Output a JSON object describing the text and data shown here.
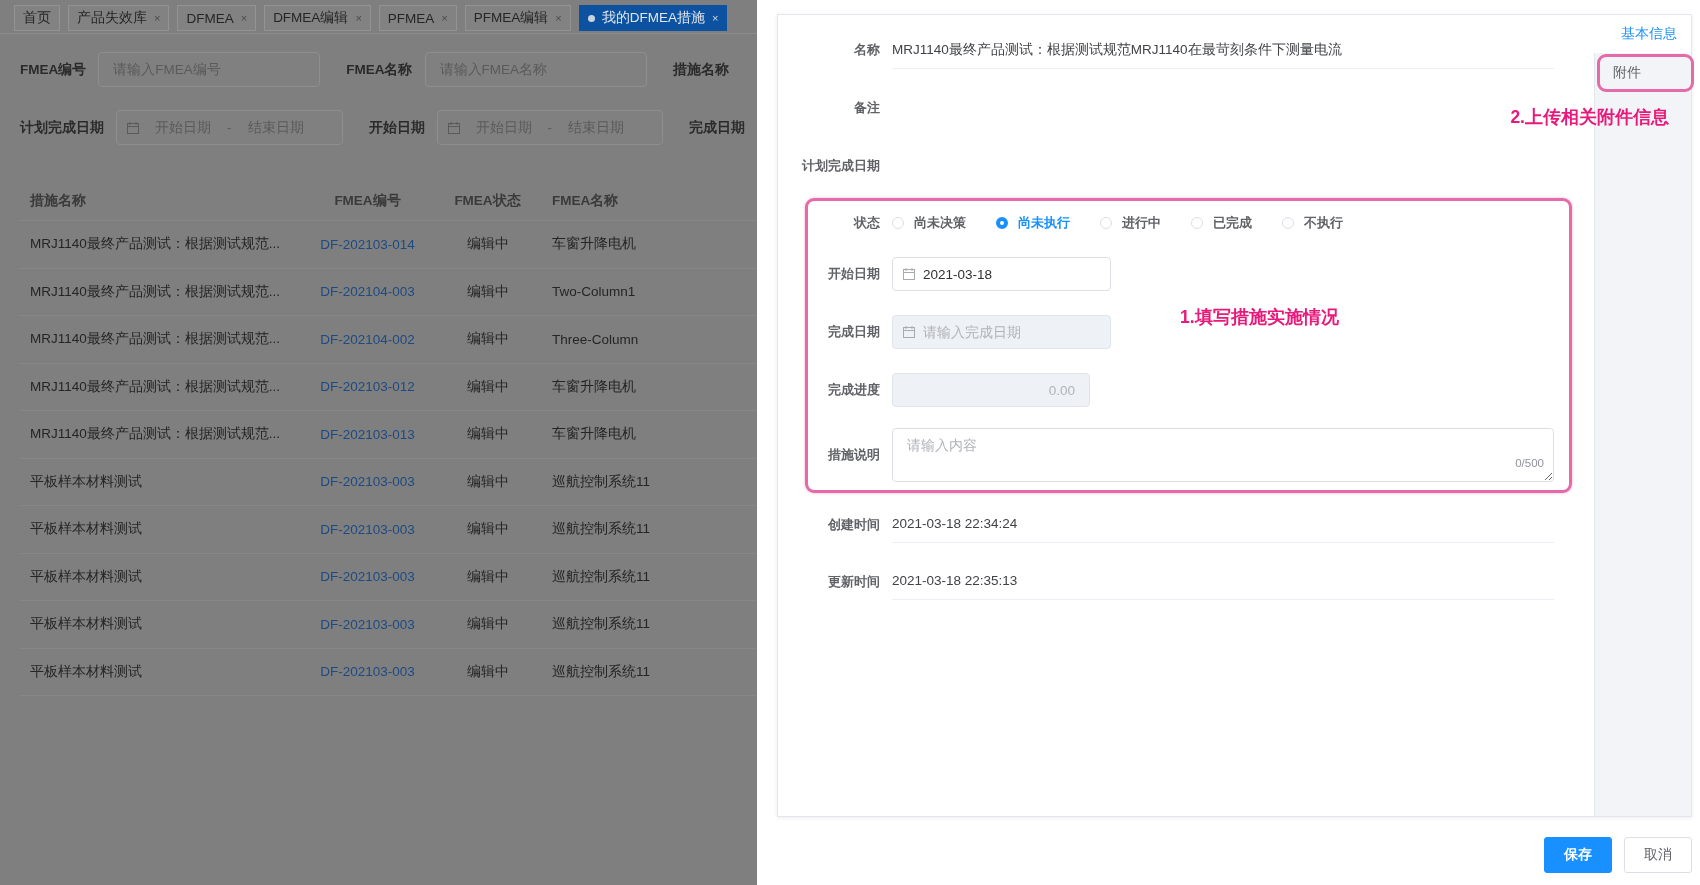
{
  "tabs": [
    {
      "label": "首页",
      "selected": false
    },
    {
      "label": "产品失效库",
      "close": "×",
      "selected": false
    },
    {
      "label": "DFMEA",
      "close": "×",
      "selected": false
    },
    {
      "label": "DFMEA编辑",
      "close": "×",
      "selected": false
    },
    {
      "label": "PFMEA",
      "close": "×",
      "selected": false
    },
    {
      "label": "PFMEA编辑",
      "close": "×",
      "selected": false
    },
    {
      "label": "我的DFMEA措施",
      "close": "×",
      "selected": true
    }
  ],
  "filter_rows": [
    [
      {
        "kind": "text",
        "label": "FMEA编号",
        "placeholder": "请输入FMEA编号"
      },
      {
        "kind": "text",
        "label": "FMEA名称",
        "placeholder": "请输入FMEA名称"
      },
      {
        "kind": "label",
        "label": "措施名称"
      }
    ],
    [
      {
        "kind": "daterange",
        "label": "计划完成日期",
        "start_placeholder": "开始日期",
        "separator": "-",
        "end_placeholder": "结束日期"
      },
      {
        "kind": "daterange",
        "label": "开始日期",
        "start_placeholder": "开始日期",
        "separator": "-",
        "end_placeholder": "结束日期"
      },
      {
        "kind": "label",
        "label": "完成日期"
      }
    ]
  ],
  "table": {
    "columns": [
      "措施名称",
      "FMEA编号",
      "FMEA状态",
      "FMEA名称"
    ],
    "rows": [
      {
        "measure": "MRJ1140最终产品测试：根据测试规范...",
        "code": "DF-202103-014",
        "status": "编辑中",
        "fmea_name": "车窗升降电机"
      },
      {
        "measure": "MRJ1140最终产品测试：根据测试规范...",
        "code": "DF-202104-003",
        "status": "编辑中",
        "fmea_name": "Two-Column1"
      },
      {
        "measure": "MRJ1140最终产品测试：根据测试规范...",
        "code": "DF-202104-002",
        "status": "编辑中",
        "fmea_name": "Three-Column"
      },
      {
        "measure": "MRJ1140最终产品测试：根据测试规范...",
        "code": "DF-202103-012",
        "status": "编辑中",
        "fmea_name": "车窗升降电机"
      },
      {
        "measure": "MRJ1140最终产品测试：根据测试规范...",
        "code": "DF-202103-013",
        "status": "编辑中",
        "fmea_name": "车窗升降电机"
      },
      {
        "measure": "平板样本材料测试",
        "code": "DF-202103-003",
        "status": "编辑中",
        "fmea_name": "巡航控制系统11"
      },
      {
        "measure": "平板样本材料测试",
        "code": "DF-202103-003",
        "status": "编辑中",
        "fmea_name": "巡航控制系统11"
      },
      {
        "measure": "平板样本材料测试",
        "code": "DF-202103-003",
        "status": "编辑中",
        "fmea_name": "巡航控制系统11"
      },
      {
        "measure": "平板样本材料测试",
        "code": "DF-202103-003",
        "status": "编辑中",
        "fmea_name": "巡航控制系统11"
      },
      {
        "measure": "平板样本材料测试",
        "code": "DF-202103-003",
        "status": "编辑中",
        "fmea_name": "巡航控制系统11"
      }
    ]
  },
  "drawer": {
    "sections": [
      {
        "highlighted": false,
        "fields": [
          {
            "kind": "display",
            "label": "名称",
            "value": "MRJ1140最终产品测试：根据测试规范MRJ1140在最苛刻条件下测量电流"
          },
          {
            "kind": "empty",
            "label": "备注"
          },
          {
            "kind": "empty",
            "label": "计划完成日期"
          }
        ]
      },
      {
        "highlighted": true,
        "annotation": "1.填写措施实施情况",
        "fields": [
          {
            "kind": "radio",
            "label": "状态",
            "options": [
              {
                "label": "尚未决策",
                "selected": false
              },
              {
                "label": "尚未执行",
                "selected": true
              },
              {
                "label": "进行中",
                "selected": false
              },
              {
                "label": "已完成",
                "selected": false
              },
              {
                "label": "不执行",
                "selected": false
              }
            ]
          },
          {
            "kind": "date",
            "label": "开始日期",
            "value": "2021-03-18",
            "disabled": false
          },
          {
            "kind": "date",
            "label": "完成日期",
            "placeholder": "请输入完成日期",
            "disabled": true
          },
          {
            "kind": "number",
            "label": "完成进度",
            "value": "0.00",
            "disabled": true
          },
          {
            "kind": "textarea",
            "label": "措施说明",
            "placeholder": "请输入内容",
            "counter": "0/500"
          }
        ]
      },
      {
        "highlighted": false,
        "fields": [
          {
            "kind": "display",
            "label": "创建时间",
            "value": "2021-03-18 22:34:24"
          },
          {
            "kind": "display",
            "label": "更新时间",
            "value": "2021-03-18 22:35:13"
          }
        ]
      }
    ],
    "side_nav": [
      {
        "label": "基本信息",
        "selected": true,
        "highlighted": false
      },
      {
        "label": "附件",
        "selected": false,
        "highlighted": true,
        "annotation": "2.上传相关附件信息"
      }
    ],
    "buttons": [
      {
        "label": "保存",
        "kind": "primary"
      },
      {
        "label": "取消",
        "kind": "default"
      }
    ]
  }
}
